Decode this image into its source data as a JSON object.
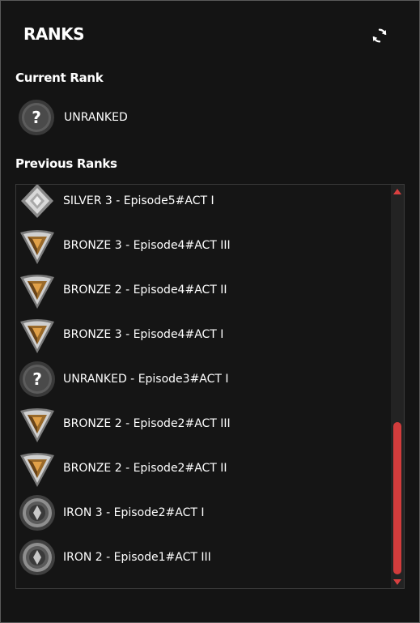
{
  "app": {
    "logo_text": "RANKS",
    "refresh_icon": "refresh-icon"
  },
  "current": {
    "title": "Current Rank",
    "rank": {
      "label": "UNRANKED",
      "tier": "unranked"
    }
  },
  "previous": {
    "title": "Previous Ranks",
    "items": [
      {
        "label": "SILVER 3 - Episode5#ACT I",
        "tier": "silver"
      },
      {
        "label": "BRONZE 3 - Episode4#ACT III",
        "tier": "bronze"
      },
      {
        "label": "BRONZE 2 - Episode4#ACT II",
        "tier": "bronze"
      },
      {
        "label": "BRONZE 3 - Episode4#ACT I",
        "tier": "bronze"
      },
      {
        "label": "UNRANKED - Episode3#ACT I",
        "tier": "unranked"
      },
      {
        "label": "BRONZE 2 - Episode2#ACT III",
        "tier": "bronze"
      },
      {
        "label": "BRONZE 2 - Episode2#ACT II",
        "tier": "bronze"
      },
      {
        "label": "IRON 3 - Episode2#ACT I",
        "tier": "iron"
      },
      {
        "label": "IRON 2 - Episode1#ACT III",
        "tier": "iron"
      }
    ]
  },
  "scrollbar": {
    "position": 0.6
  },
  "colors": {
    "background": "#141414",
    "accent": "#d23c3c",
    "text": "#ffffff"
  }
}
